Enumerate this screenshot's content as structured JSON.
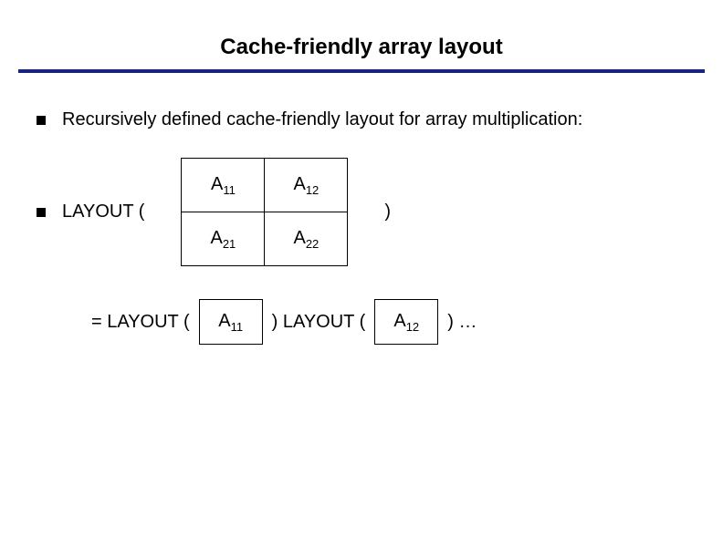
{
  "title": "Cache-friendly array layout",
  "bullet1": "Recursively defined cache-friendly layout for array multiplication:",
  "layout_label": "LAYOUT  (",
  "close_paren": ")",
  "matrix": {
    "a11": "A",
    "a11s": "11",
    "a12": "A",
    "a12s": "12",
    "a21": "A",
    "a21s": "21",
    "a22": "A",
    "a22s": "22"
  },
  "eq": {
    "eq_prefix": "=  LAYOUT (",
    "a11": "A",
    "a11s": "11",
    "mid": ") LAYOUT (",
    "a12": "A",
    "a12s": "12",
    "tail": ") …"
  }
}
